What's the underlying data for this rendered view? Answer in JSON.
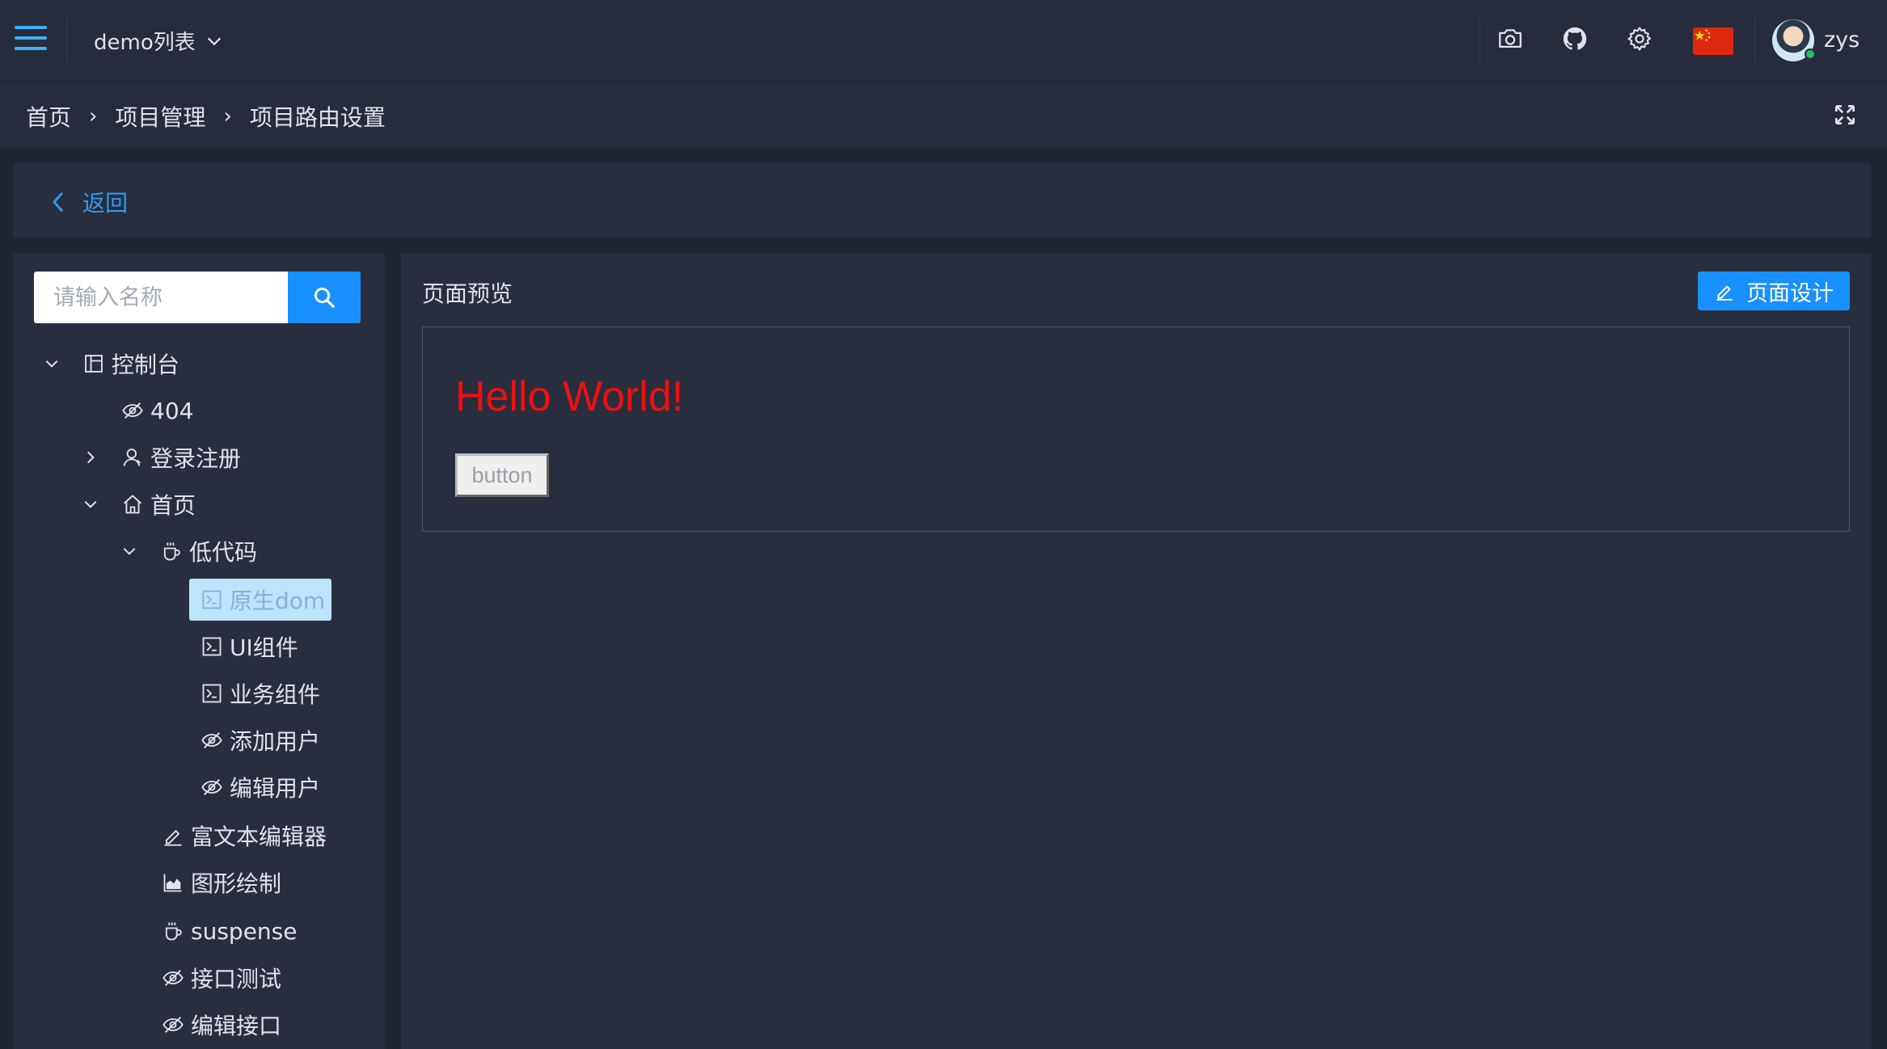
{
  "header": {
    "app_title": "demo列表",
    "username": "zys"
  },
  "breadcrumb": {
    "items": [
      "首页",
      "项目管理",
      "项目路由设置"
    ],
    "separator": "›"
  },
  "back": {
    "label": "返回"
  },
  "search": {
    "placeholder": "请输入名称"
  },
  "tree": {
    "nodes": [
      {
        "label": "控制台",
        "icon": "layout-icon",
        "expanded": true
      },
      {
        "label": "404",
        "icon": "eye-off-icon"
      },
      {
        "label": "登录注册",
        "icon": "user-icon",
        "expanded": false
      },
      {
        "label": "首页",
        "icon": "home-icon",
        "expanded": true
      },
      {
        "label": "低代码",
        "icon": "cup-icon",
        "expanded": true
      },
      {
        "label": "原生dom",
        "icon": "terminal-icon",
        "selected": true
      },
      {
        "label": "UI组件",
        "icon": "terminal-icon"
      },
      {
        "label": "业务组件",
        "icon": "terminal-icon"
      },
      {
        "label": "添加用户",
        "icon": "eye-off-icon"
      },
      {
        "label": "编辑用户",
        "icon": "eye-off-icon"
      },
      {
        "label": "富文本编辑器",
        "icon": "edit-icon"
      },
      {
        "label": "图形绘制",
        "icon": "area-chart-icon"
      },
      {
        "label": "suspense",
        "icon": "cup-icon"
      },
      {
        "label": "接口测试",
        "icon": "eye-off-icon"
      },
      {
        "label": "编辑接口",
        "icon": "eye-off-icon"
      }
    ]
  },
  "preview": {
    "title": "页面预览",
    "design_button": "页面设计",
    "hello_text": "Hello World!",
    "demo_button": "button"
  },
  "colors": {
    "accent": "#1890ff",
    "link": "#2e9bf0",
    "hello": "#ef1010",
    "selected_bg": "#bde3ff",
    "status_online": "#20c05c"
  }
}
